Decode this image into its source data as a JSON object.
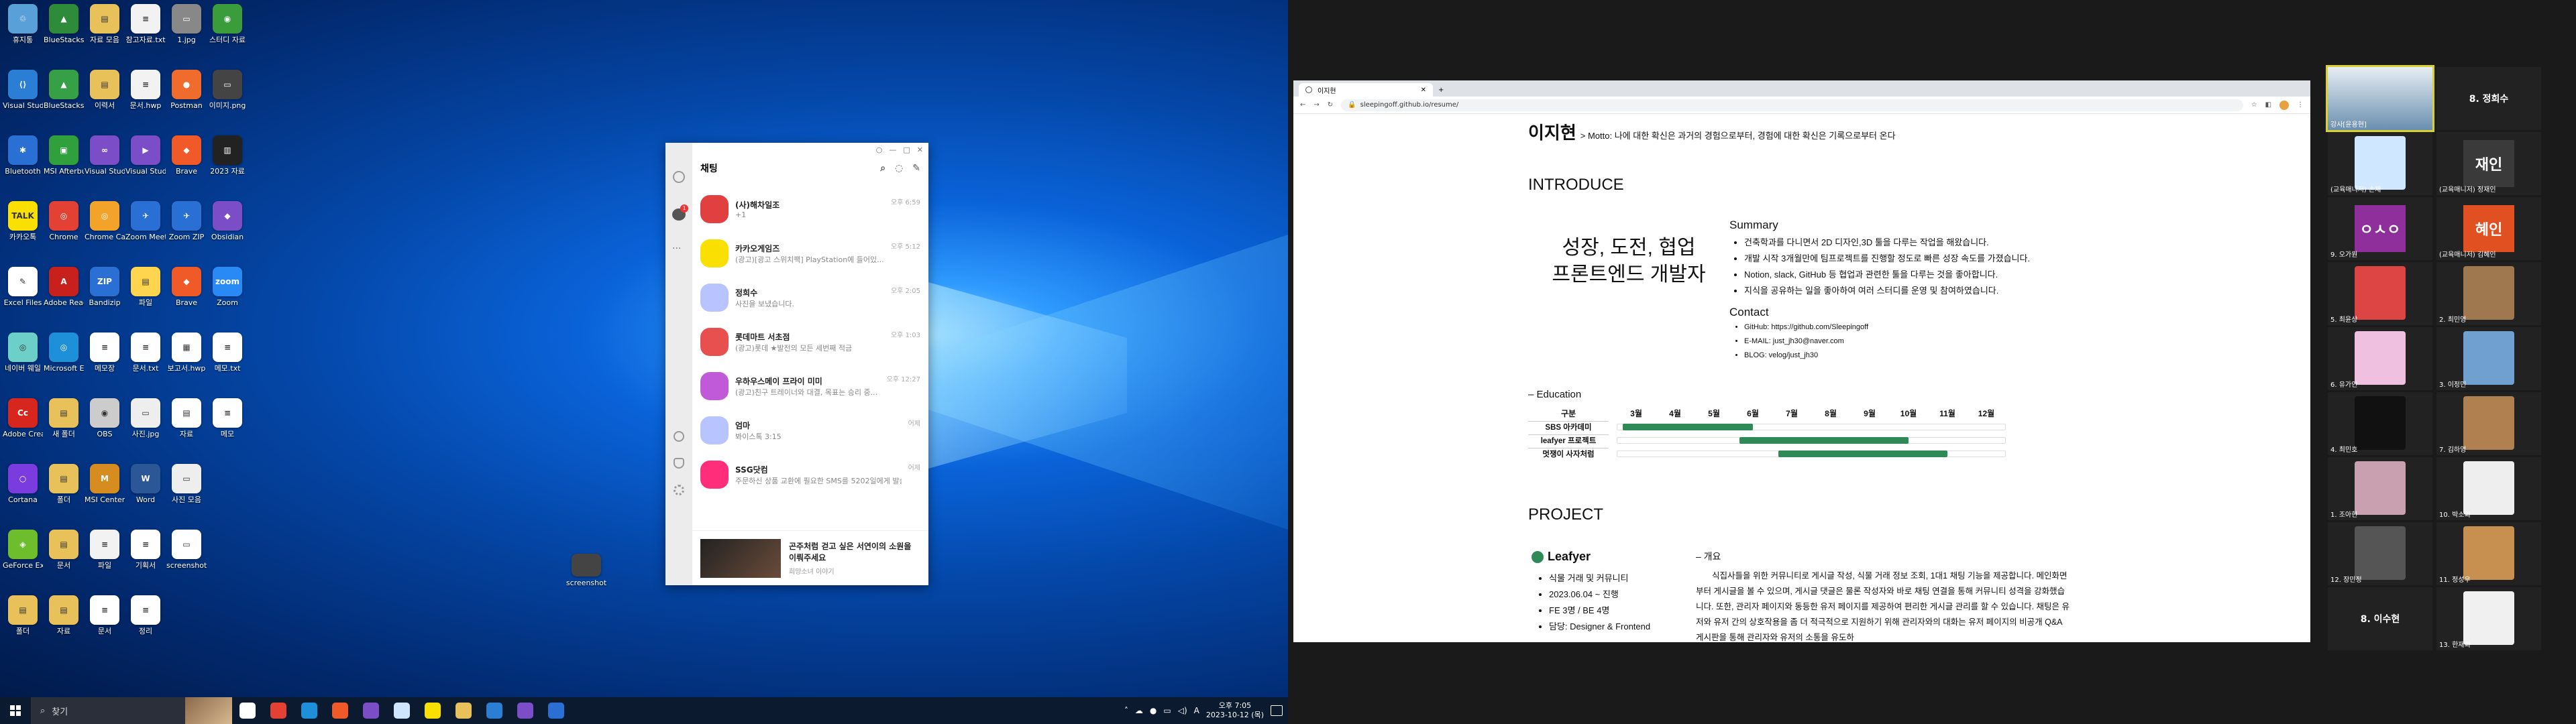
{
  "desktop": {
    "icons": [
      {
        "label": "휴지통",
        "color": "#5aa0d8",
        "g": "♲"
      },
      {
        "label": "BlueStacks 5",
        "color": "#2e8b3a",
        "g": "▲"
      },
      {
        "label": "자료 모음",
        "color": "#e8c15a",
        "g": "▤"
      },
      {
        "label": "참고자료.txt",
        "color": "#f2f2f2",
        "g": "≡"
      },
      {
        "label": "1.jpg",
        "color": "#888",
        "g": "▭"
      },
      {
        "label": "스터디 자료",
        "color": "#3b9c3b",
        "g": "◉"
      },
      {
        "label": "Visual Studio Code",
        "color": "#2a7fd4",
        "g": "⟨⟩"
      },
      {
        "label": "BlueStacks 5 Multi",
        "color": "#35a045",
        "g": "▲"
      },
      {
        "label": "이력서",
        "color": "#e8c15a",
        "g": "▤"
      },
      {
        "label": "문서.hwp",
        "color": "#f2f2f2",
        "g": "≡"
      },
      {
        "label": "Postman",
        "color": "#ef6c2d",
        "g": "●"
      },
      {
        "label": "이미지.png",
        "color": "#444",
        "g": "▭"
      },
      {
        "label": "Bluetooth",
        "color": "#2a6fd4",
        "g": "✱"
      },
      {
        "label": "MSI Afterburner",
        "color": "#2fa03c",
        "g": "▣"
      },
      {
        "label": "Visual Studio",
        "color": "#7b4ec7",
        "g": "∞"
      },
      {
        "label": "Visual Studio 2022",
        "color": "#7b4ec7",
        "g": "▶"
      },
      {
        "label": "Brave",
        "color": "#f05a28",
        "g": "◆"
      },
      {
        "label": "2023 자료",
        "color": "#222",
        "g": "▥"
      },
      {
        "label": "카카오톡",
        "color": "#f9e000",
        "g": "TALK"
      },
      {
        "label": "Chrome",
        "color": "#e34133",
        "g": "◎"
      },
      {
        "label": "Chrome Canary",
        "color": "#f4a32a",
        "g": "◎"
      },
      {
        "label": "Zoom Meeting",
        "color": "#2a6fd4",
        "g": "✈"
      },
      {
        "label": "Zoom ZIP",
        "color": "#2a6fd4",
        "g": "✈"
      },
      {
        "label": "Obsidian",
        "color": "#7b4ec7",
        "g": "◆"
      },
      {
        "label": "Excel Files",
        "color": "#fff",
        "g": "✎"
      },
      {
        "label": "Adobe Reader",
        "color": "#c8201c",
        "g": "A"
      },
      {
        "label": "Bandizip",
        "color": "#2a6fd4",
        "g": "ZIP"
      },
      {
        "label": "파일",
        "color": "#ffd54f",
        "g": "▤"
      },
      {
        "label": "Brave",
        "color": "#f05a28",
        "g": "◆"
      },
      {
        "label": "Zoom",
        "color": "#2a8af5",
        "g": "zoom"
      },
      {
        "label": "네이버 웨일",
        "color": "#6dd0c8",
        "g": "◎"
      },
      {
        "label": "Microsoft Edge",
        "color": "#1e8fd9",
        "g": "◎"
      },
      {
        "label": "메모장",
        "color": "#fff",
        "g": "≡"
      },
      {
        "label": "문서.txt",
        "color": "#fff",
        "g": "≡"
      },
      {
        "label": "보고서.hwp",
        "color": "#fff",
        "g": "▦"
      },
      {
        "label": "메모.txt",
        "color": "#fff",
        "g": "≡"
      },
      {
        "label": "Adobe Creative Cloud",
        "color": "#d6261e",
        "g": "Cc"
      },
      {
        "label": "새 폴더",
        "color": "#e8c15a",
        "g": "▤"
      },
      {
        "label": "OBS",
        "color": "#ccc",
        "g": "◉"
      },
      {
        "label": "사진.jpg",
        "color": "#eee",
        "g": "▭"
      },
      {
        "label": "자료",
        "color": "#fff",
        "g": "▤"
      },
      {
        "label": "메모",
        "color": "#fff",
        "g": "≡"
      },
      {
        "label": "Cortana",
        "color": "#7a3bdf",
        "g": "○"
      },
      {
        "label": "폴더",
        "color": "#e8c15a",
        "g": "▤"
      },
      {
        "label": "MSI Center",
        "color": "#d68c1e",
        "g": "M"
      },
      {
        "label": "Word",
        "color": "#2b5797",
        "g": "W"
      },
      {
        "label": "사진 모음",
        "color": "#eee",
        "g": "▭"
      },
      {
        "label": "",
        "color": "transparent",
        "g": ""
      },
      {
        "label": "GeForce Experience",
        "color": "#6ebd2c",
        "g": "◈"
      },
      {
        "label": "문서",
        "color": "#e8c15a",
        "g": "▤"
      },
      {
        "label": "파일",
        "color": "#f2f2f2",
        "g": "≡"
      },
      {
        "label": "기획서",
        "color": "#fff",
        "g": "≡"
      },
      {
        "label": "screenshot",
        "color": "#fff",
        "g": "▭"
      },
      {
        "label": "",
        "color": "transparent",
        "g": ""
      },
      {
        "label": "폴더",
        "color": "#e8c15a",
        "g": "▤"
      },
      {
        "label": "자료",
        "color": "#e8c15a",
        "g": "▤"
      },
      {
        "label": "문서",
        "color": "#fff",
        "g": "≡"
      },
      {
        "label": "정리",
        "color": "#fff",
        "g": "≡"
      },
      {
        "label": "",
        "color": "transparent",
        "g": ""
      },
      {
        "label": "",
        "color": "transparent",
        "g": ""
      }
    ],
    "lone_icon": {
      "label": "screenshot",
      "color": "#444"
    }
  },
  "taskbar": {
    "search_placeholder": "찾기",
    "apps": [
      {
        "name": "task-view",
        "color": "#ffffff"
      },
      {
        "name": "chrome",
        "color": "#e34133"
      },
      {
        "name": "edge",
        "color": "#1e8fd9"
      },
      {
        "name": "brave",
        "color": "#f05a28"
      },
      {
        "name": "vs",
        "color": "#7b4ec7"
      },
      {
        "name": "notepad",
        "color": "#cfe6ff"
      },
      {
        "name": "kakaotalk",
        "color": "#f9e000"
      },
      {
        "name": "explorer",
        "color": "#e8c15a"
      },
      {
        "name": "vscode",
        "color": "#2a7fd4"
      },
      {
        "name": "obsidian",
        "color": "#7b4ec7"
      },
      {
        "name": "zoom",
        "color": "#2a6fd4"
      }
    ],
    "tray_text": "A",
    "time": "오후 7:05",
    "date": "2023-10-12 (목)"
  },
  "kakao": {
    "title": "채팅",
    "chats": [
      {
        "name": "(사)해차일조",
        "msg": "+1",
        "time": "오후 6:59",
        "color": "#e04040"
      },
      {
        "name": "카카오게임즈",
        "msg": "(광고)[광고 스위치팩] PlayStation에 들어있...",
        "time": "오후 5:12",
        "color": "#f9e000"
      },
      {
        "name": "정희수",
        "msg": "사진을 보냈습니다.",
        "time": "오후 2:05",
        "color": "#b8c4ff"
      },
      {
        "name": "롯데마트 서초점",
        "msg": "(광고)롯데 ★발전의 모든 세번째 적금",
        "time": "오후 1:03",
        "color": "#e85050"
      },
      {
        "name": "우하우스메이 프라이 미미",
        "msg": "(광고)친구 트레이너와 대결, 목표는 승리 중...",
        "time": "오후 12:27",
        "color": "#c05ad8"
      },
      {
        "name": "엄마",
        "msg": "봐이스톡 3:15",
        "time": "어제",
        "color": "#b8c4ff"
      },
      {
        "name": "SSG닷컴",
        "msg": "주문하신 상품 교환에 필요한 SMS를 5202일에게 발송하였습...",
        "time": "어제",
        "color": "#ff2d7a"
      }
    ],
    "ad_title": "곤주처럼 걷고 싶은 서연이의 소원을 이뤄주세요",
    "ad_sub": "희망소녀 이야기"
  },
  "browser": {
    "tab_title": "이지현",
    "url": "sleepingoff.github.io/resume/",
    "name": "이지현",
    "motto": "> Motto: 나에 대한 확신은 과거의 경험으로부터, 경험에 대한 확신은 기록으로부터 온다",
    "introduce": "INTRODUCE",
    "slogan1": "성장, 도전, 협업",
    "slogan2": "프론트엔드 개발자",
    "summary_title": "Summary",
    "summary": [
      "건축학과를 다니면서 2D 디자인,3D 툴을 다루는 작업을 해왔습니다.",
      "개발 시작 3개월만에 팀프로젝트를 진행할 정도로 빠른 성장 속도를 가졌습니다.",
      "Notion, slack, GitHub 등 협업과 관련한 툴을 다루는 것을 좋아합니다.",
      "지식을 공유하는 일을 좋아하여 여러 스터디를 운영 및 참여하였습니다."
    ],
    "contact_title": "Contact",
    "contact": [
      "GitHub: https://github.com/Sleepingoff",
      "E-MAIL: just_jh30@naver.com",
      "BLOG: velog/just_jh30"
    ],
    "education_title": "–  Education",
    "edu_header": "구분",
    "months": [
      "3월",
      "4월",
      "5월",
      "6월",
      "7월",
      "8월",
      "9월",
      "10월",
      "11월",
      "12월"
    ],
    "edu_rows": [
      {
        "label": "SBS 아카데미",
        "start": 3,
        "end": 6
      },
      {
        "label": "leafyer 프로젝트",
        "start": 6,
        "end": 10
      },
      {
        "label": "멋쟁이 사자처럼",
        "start": 7,
        "end": 11
      }
    ],
    "project_title": "PROJECT",
    "project_name": "Leafyer",
    "project_meta": [
      "식물 거래 및 커뮤니티",
      "2023.06.04 ~ 진행",
      "FE 3명 / BE 4명",
      "담당: Designer & Frontend"
    ],
    "overview_title": "–  개요",
    "overview": "식집사들을 위한 커뮤니티로 게시글 작성, 식물 거래 정보 조회, 1대1 채팅 기능을 제공합니다. 메인화면부터 게시글을 볼 수 있으며, 게시글 댓글은 물론 작성자와 바로 채팅 연결을 통해 커뮤니티 성격을 강화했습니다. 또한, 관리자 페이지와 동등한 유저 페이지를 제공하여 편리한 게시글 관리를 할 수 있습니다. 채팅은 유저와 유저 간의 상호작용을 좀 더 적극적으로 지원하기 위해 관리자와의 대화는 유저 페이지의 비공개 Q&A 게시판을 통해 관리자와 유저의 소통을 유도하"
  },
  "zoom": {
    "tiles": [
      {
        "name": "강사[윤용현]",
        "kind": "person",
        "color": "#6a8fb0"
      },
      {
        "name": "8. 정희수",
        "kind": "nameonly",
        "color": "#2a2a2a"
      },
      {
        "name": "(교육매니저) 손재",
        "kind": "dog",
        "color": "#d0e8ff"
      },
      {
        "name": "(교육매니저) 정재인",
        "kind": "text",
        "text": "재인",
        "color": "#3a3a3a"
      },
      {
        "name": "9. 오가원",
        "kind": "text",
        "text": "ㅇㅅㅇ",
        "color": "#8e2f9c"
      },
      {
        "name": "(교육매니저) 김혜인",
        "kind": "text",
        "text": "혜인",
        "color": "#e05020"
      },
      {
        "name": "5. 최윤상",
        "kind": "img",
        "color": "#d44"
      },
      {
        "name": "2. 최민영",
        "kind": "img",
        "color": "#a07850"
      },
      {
        "name": "6. 유가인",
        "kind": "img",
        "color": "#f0c0e0"
      },
      {
        "name": "3. 이정민",
        "kind": "img",
        "color": "#70a0d0"
      },
      {
        "name": "4. 최민호",
        "kind": "img",
        "color": "#111"
      },
      {
        "name": "7. 김하영",
        "kind": "img",
        "color": "#b08050"
      },
      {
        "name": "1. 조아현",
        "kind": "img",
        "color": "#c8a0b0"
      },
      {
        "name": "10. 박소희",
        "kind": "img",
        "color": "#eee"
      },
      {
        "name": "12. 장민정",
        "kind": "img",
        "color": "#555"
      },
      {
        "name": "11. 정성우",
        "kind": "img",
        "color": "#c89050"
      },
      {
        "name": "8. 이수현",
        "kind": "nameonly",
        "color": "#2a2a2a"
      },
      {
        "name": "13. 한재희",
        "kind": "img",
        "color": "#f0f0f0"
      }
    ]
  }
}
